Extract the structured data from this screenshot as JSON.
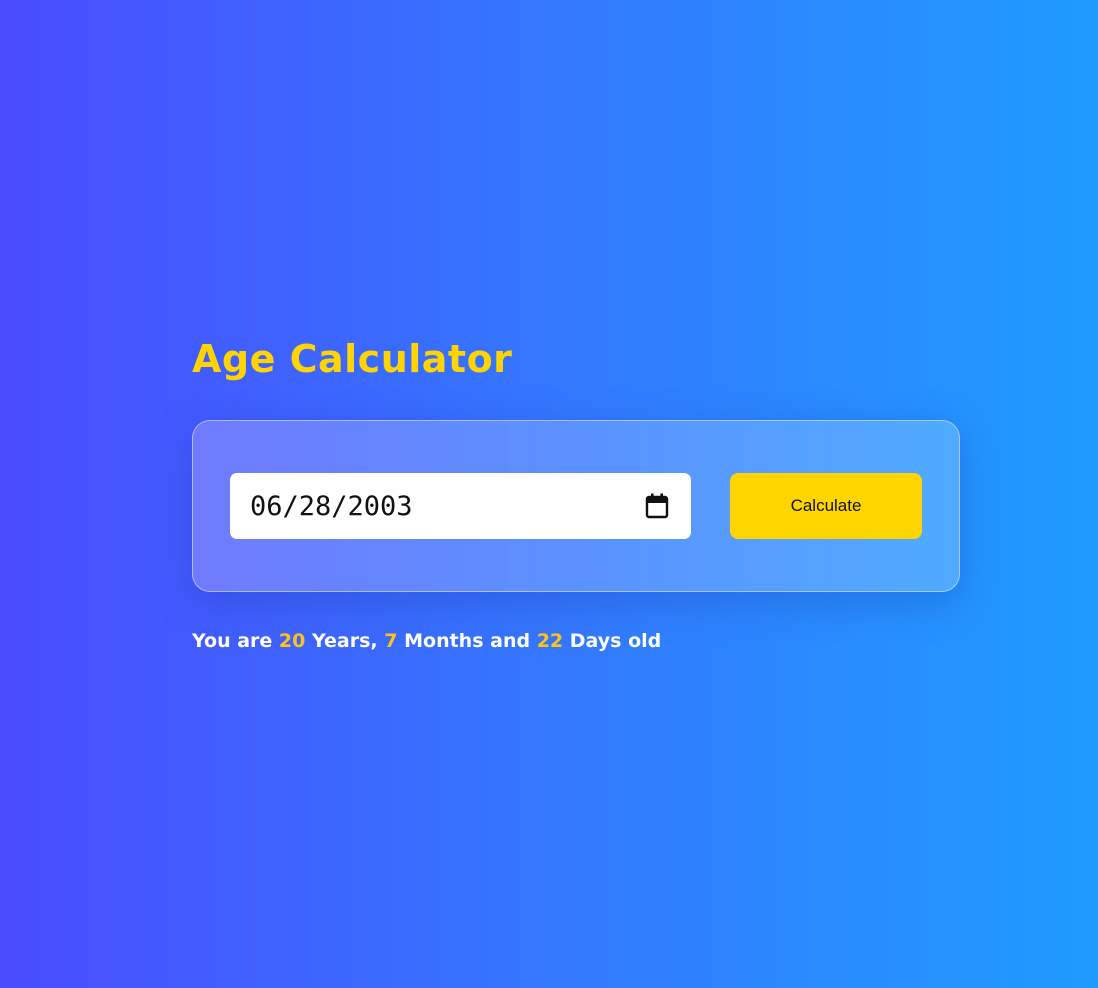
{
  "app": {
    "title": "Age Calculator"
  },
  "form": {
    "date_value": "06/28/2003",
    "calculate_label": "Calculate"
  },
  "result": {
    "prefix": "You are",
    "years": "20",
    "years_label": "Years,",
    "months": "7",
    "months_label": "Months and",
    "days": "22",
    "days_label": "Days old"
  },
  "icons": {
    "calendar": "calendar-icon"
  },
  "colors": {
    "accent": "#ffd500",
    "title": "#ffd400",
    "number_highlight": "#ffc21a",
    "background_start": "#4a4cff",
    "background_end": "#1f9bff"
  }
}
